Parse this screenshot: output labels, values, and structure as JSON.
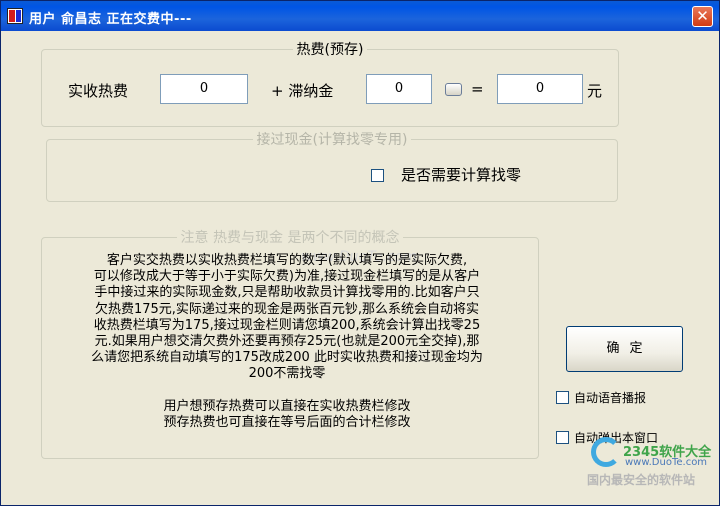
{
  "window": {
    "title": "用户  俞昌志  正在交费中---",
    "close_symbol": "✕"
  },
  "heat_group": {
    "title": "热费(预存)",
    "received_label": "实收热费",
    "received_value": "0",
    "plus_label": "+  滞纳金",
    "late_fee_value": "0",
    "equals_label": "=",
    "total_value": "0",
    "unit_label": "元"
  },
  "cash_group": {
    "title": "接过现金(计算找零专用)",
    "calc_change_label": "是否需要计算找零"
  },
  "note_group": {
    "title": "注意  热费与现金  是两个不同的概念",
    "paragraph1": "客户实交热费以实收热费栏填写的数字(默认填写的是实际欠费,\n可以修改成大于等于小于实际欠费)为准,接过现金栏填写的是从客户\n手中接过来的实际现金数,只是帮助收款员计算找零用的.比如客户只\n欠热费175元,实际递过来的现金是两张百元钞,那么系统会自动将实\n收热费栏填写为175,接过现金栏则请您填200,系统会计算出找零25\n元.如果用户想交清欠费外还要再预存25元(也就是200元全交掉),那\n么请您把系统自动填写的175改成200  此时实收热费和接过现金均为\n200不需找零",
    "paragraph2": "用户想预存热费可以直接在实收热费栏修改\n预存热费也可直接在等号后面的合计栏修改"
  },
  "side": {
    "ok_label": "确定",
    "auto_voice_label": "自动语音播报",
    "auto_popup_label": "自动弹出本窗口"
  },
  "watermark": {
    "brand": "2345软件大全",
    "url": "www.DuoTe.com",
    "footer": "国内最安全的软件站",
    "bg_text": "www.DuoTe.com"
  }
}
